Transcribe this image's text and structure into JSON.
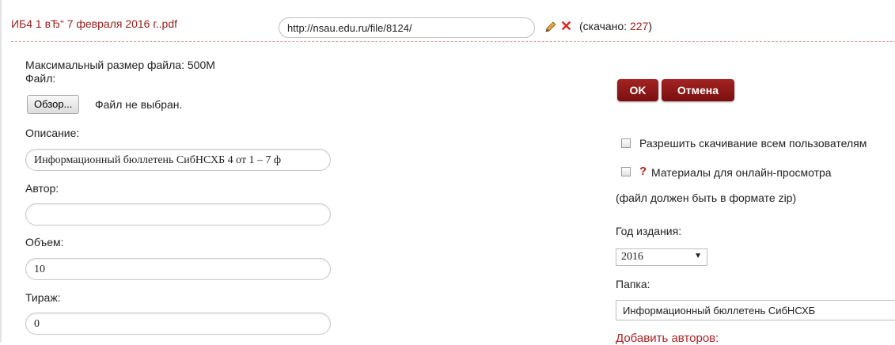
{
  "header": {
    "file_title": "ИБ4 1 вЂ“ 7 февраля 2016 г..pdf",
    "url_value": "http://nsau.edu.ru/file/8124/",
    "download_prefix": "(скачано: ",
    "download_count": "227",
    "download_suffix": ")"
  },
  "upload": {
    "max_size": "Максимальный размер файла: 500M",
    "file_label": "Файл:",
    "browse_label": "Обзор...",
    "file_status": "Файл не выбран."
  },
  "form": {
    "description_label": "Описание:",
    "description_value": "Информационный бюллетень СибНСХБ 4 от 1 – 7 ф",
    "author_label": "Автор:",
    "author_value": "",
    "volume_label": "Объем:",
    "volume_value": "10",
    "copies_label": "Тираж:",
    "copies_value": "0"
  },
  "actions": {
    "ok_label": "OK",
    "cancel_label": "Отмена"
  },
  "options": {
    "allow_download_label": "Разрешить скачивание всем пользователям",
    "help_mark": "?",
    "online_view_label": "Материалы для онлайн-просмотра",
    "zip_note": "(файл должен быть в формате zip)",
    "year_label": "Год издания:",
    "year_value": "2016",
    "folder_label": "Папка:",
    "folder_value": "Информационный бюллетень СибНСХБ",
    "add_authors_label": "Добавить авторов:"
  },
  "colors": {
    "accent_dark_red": "#9a1c1c",
    "button_red": "#8b1717",
    "delete_red": "#d6281e"
  },
  "icons": [
    "pencil-icon",
    "close-icon",
    "chevron-down-icon",
    "question-icon"
  ]
}
